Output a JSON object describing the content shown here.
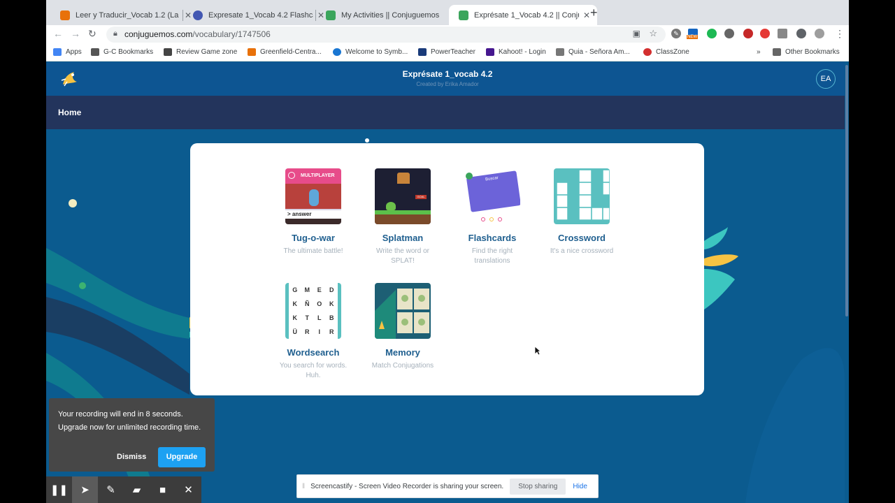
{
  "browser": {
    "tabs": [
      {
        "title": "Leer y Traducir_Vocab 1.2 (La F",
        "color": "#e8710a"
      },
      {
        "title": "Expresate 1_Vocab 4.2 Flashca",
        "color": "#4257b2"
      },
      {
        "title": "My Activities || Conjuguemos",
        "color": "#3ba55c"
      },
      {
        "title": "Exprésate 1_Vocab 4.2 || Conju",
        "color": "#3ba55c"
      }
    ],
    "url_domain": "conjuguemos.com",
    "url_path": "/vocabulary/1747506",
    "bookmarks": [
      "Apps",
      "G-C Bookmarks",
      "Review Game zone",
      "Greenfield-Centra...",
      "Welcome to Symb...",
      "PowerTeacher",
      "Kahoot! - Login",
      "Quia - Señora Am...",
      "ClassZone"
    ],
    "other_bookmarks": "Other Bookmarks",
    "overflow": "»",
    "new_badge": "NEW"
  },
  "site": {
    "title": "Exprésate 1_vocab 4.2",
    "subtitle": "Created by Erika Amador",
    "avatar": "EA",
    "nav_home": "Home"
  },
  "games": [
    {
      "name": "Tug-o-war",
      "desc": "The ultimate battle!"
    },
    {
      "name": "Splatman",
      "desc": "Write the word or SPLAT!"
    },
    {
      "name": "Flashcards",
      "desc": "Find the right translations"
    },
    {
      "name": "Crossword",
      "desc": "It's a nice crossword"
    },
    {
      "name": "Wordsearch",
      "desc": "You search for words. Huh."
    },
    {
      "name": "Memory",
      "desc": "Match Conjugations"
    }
  ],
  "thumbs": {
    "tug_label": "MULTIPLAYER",
    "tug_answer": "> answer",
    "flash_title": "Buscar",
    "splat_goal": "GOAL",
    "wordsearch_letters": [
      "G",
      "M",
      "E",
      "D",
      "K",
      "Ñ",
      "O",
      "K",
      "K",
      "T",
      "L",
      "B",
      "Ü",
      "R",
      "I",
      "R"
    ]
  },
  "recorder": {
    "line1": "Your recording will end in 8 seconds.",
    "line2": "Upgrade now for unlimited recording time.",
    "dismiss": "Dismiss",
    "upgrade": "Upgrade"
  },
  "share_bar": {
    "message": "Screencastify - Screen Video Recorder is sharing your screen.",
    "stop": "Stop sharing",
    "hide": "Hide"
  }
}
